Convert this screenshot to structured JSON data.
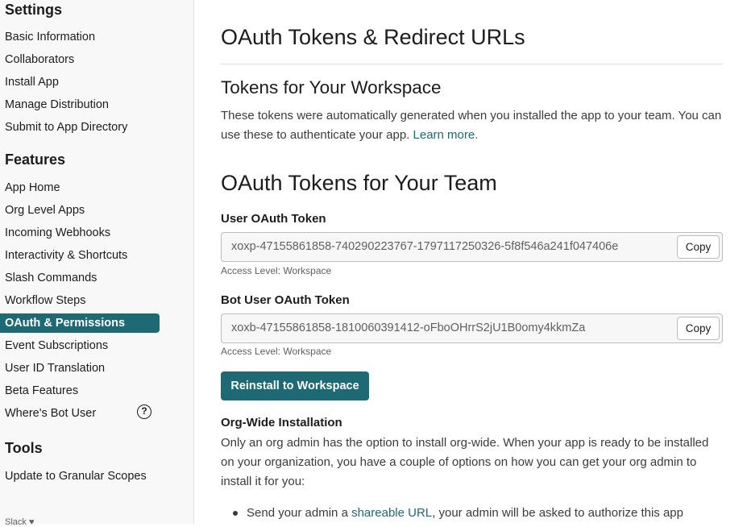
{
  "sidebar": {
    "settings_heading": "Settings",
    "settings_items": [
      {
        "label": "Basic Information"
      },
      {
        "label": "Collaborators"
      },
      {
        "label": "Install App"
      },
      {
        "label": "Manage Distribution"
      },
      {
        "label": "Submit to App Directory"
      }
    ],
    "features_heading": "Features",
    "features_items": [
      {
        "label": "App Home"
      },
      {
        "label": "Org Level Apps"
      },
      {
        "label": "Incoming Webhooks"
      },
      {
        "label": "Interactivity & Shortcuts"
      },
      {
        "label": "Slash Commands"
      },
      {
        "label": "Workflow Steps"
      },
      {
        "label": "OAuth & Permissions",
        "active": true
      },
      {
        "label": "Event Subscriptions"
      },
      {
        "label": "User ID Translation"
      },
      {
        "label": "Beta Features"
      },
      {
        "label": "Where's Bot User"
      }
    ],
    "help_icon": "?",
    "tools_heading": "Tools",
    "tools_items": [
      {
        "label": "Update to Granular Scopes"
      }
    ],
    "footer_text": "Slack ♥"
  },
  "main": {
    "title": "OAuth Tokens & Redirect URLs",
    "tokens_section": {
      "heading": "Tokens for Your Workspace",
      "description_part1": "These tokens were automatically generated when you installed the app to your team. You can use these to authenticate your app.",
      "learn_more": "Learn more."
    },
    "team_section": {
      "heading": "OAuth Tokens for Your Team",
      "user_token": {
        "label": "User OAuth Token",
        "value": "xoxp-47155861858-740290223767-1797117250326-5f8f546a241f047406e",
        "copy_label": "Copy",
        "access_level": "Access Level: Workspace"
      },
      "bot_token": {
        "label": "Bot User OAuth Token",
        "value": "xoxb-47155861858-1810060391412-oFboOHrrS2jU1B0omy4kkmZa",
        "copy_label": "Copy",
        "access_level": "Access Level: Workspace"
      },
      "reinstall_label": "Reinstall to Workspace"
    },
    "org_wide": {
      "heading": "Org-Wide Installation",
      "description": "Only an org admin has the option to install org-wide. When your app is ready to be installed on your organization, you have a couple of options on how you can get your org admin to install it for you:",
      "bullet_prefix": "Send your admin a",
      "bullet_link": "shareable URL",
      "bullet_suffix": ", your admin will be asked to authorize this app"
    }
  },
  "colors": {
    "accent": "#1d6a74",
    "link": "#1a6b78",
    "sidebar_bg": "#f8f8f8"
  }
}
